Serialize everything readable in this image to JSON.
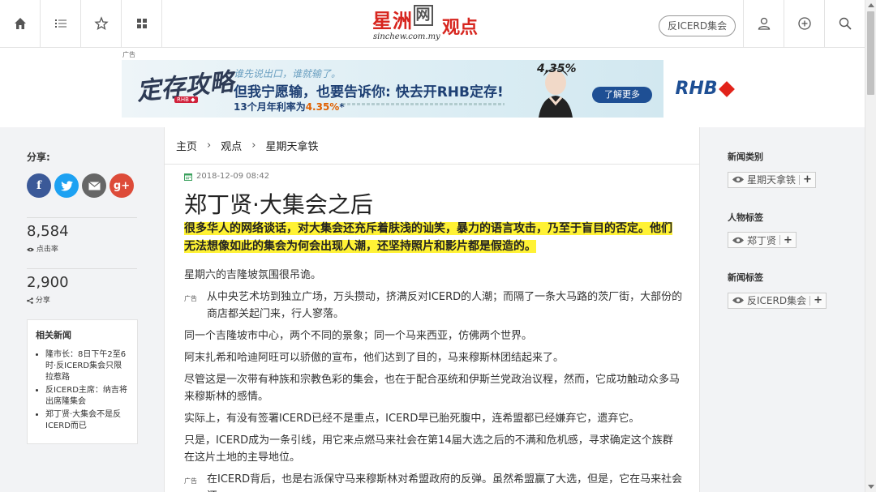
{
  "nav": {
    "left_icons": [
      "home-icon",
      "list-icon",
      "star-icon",
      "grid-icon"
    ],
    "right_icons": [
      "user-icon",
      "plus-circle-icon",
      "search-icon"
    ],
    "logo_text": "星洲",
    "logo_box_text": "网",
    "logo_sub": "sinchew.com.my",
    "section_title": "观点",
    "tag_pill": "反ICERD集会"
  },
  "ad": {
    "label": "广告",
    "brand_script": "定存攻略",
    "brand_tag": "RHB ◆",
    "line1": "谁先说出口，谁就输了。",
    "line2": "但我宁愿输，也要告诉你: 快去开RHB定存!",
    "line3_prefix": "13个月年利率为",
    "line3_rate": "4.35%",
    "line3_suffix": "*",
    "rate_badge": "4.35%",
    "cta": "了解更多",
    "logo": "RHB"
  },
  "share": {
    "title": "分享:",
    "buttons": [
      "f",
      "t",
      "✉",
      "g+"
    ]
  },
  "stats": {
    "views_num": "8,584",
    "views_label": "点击率",
    "shares_num": "2,900",
    "shares_label": "分享"
  },
  "related": {
    "title": "相关新闻",
    "items": [
      "隆市长：8日下午2至6时·反ICERD集会只限拉惹路",
      "反ICERD主席：纳吉将出席隆集会",
      "郑丁贤·大集会不是反ICERD而已"
    ]
  },
  "breadcrumb": [
    "主页",
    "观点",
    "星期天拿铁"
  ],
  "article": {
    "date": "2018-12-09 08:42",
    "title": "郑丁贤·大集会之后",
    "lede": "很多华人的网络谈话，对大集会还充斥着肤浅的讪笑，暴力的语言攻击，乃至于盲目的否定。他们无法想像如此的集会为何会出现人潮，还坚持照片和影片都是假造的。",
    "paragraphs": [
      {
        "ad": "",
        "text": "星期六的吉隆坡氛围很吊诡。"
      },
      {
        "ad": "广告",
        "text": "从中央艺术坊到独立广场，万头攒动，挤满反对ICERD的人潮；而隔了一条大马路的茨厂街，大部份的商店都关起门来，行人寥落。"
      },
      {
        "ad": "",
        "text": "同一个吉隆坡市中心，两个不同的景象；同一个马来西亚，仿佛两个世界。"
      },
      {
        "ad": "",
        "text": "阿末扎希和哈迪阿旺可以骄傲的宣布，他们达到了目的，马来穆斯林团结起来了。"
      },
      {
        "ad": "",
        "text": "尽管这是一次带有种族和宗教色彩的集会，也在于配合巫统和伊斯兰党政治议程，然而，它成功触动众多马来穆斯林的感情。"
      },
      {
        "ad": "",
        "text": "实际上，有没有签署ICERD已经不是重点，ICERD早已胎死腹中，连希盟都已经嫌弃它，遗弃它。"
      },
      {
        "ad": "",
        "text": "只是，ICERD成为一条引线，用它来点燃马来社会在第14届大选之后的不满和危机感，寻求确定这个族群在这片土地的主导地位。"
      },
      {
        "ad": "广告",
        "text": "在ICERD背后，也是右派保守马来穆斯林对希盟政府的反弹。虽然希盟赢了大选，但是，它在马来社会还"
      }
    ]
  },
  "right": {
    "sections": [
      {
        "heading": "新闻类别",
        "chip": "星期天拿铁"
      },
      {
        "heading": "人物标签",
        "chip": "郑丁贤"
      },
      {
        "heading": "新闻标签",
        "chip": "反ICERD集会"
      }
    ]
  },
  "colors": {
    "brand_red": "#d7261f",
    "highlight": "#fff235",
    "facebook": "#3b5998",
    "twitter": "#1da1f2",
    "email": "#666666",
    "gplus": "#dd4b39"
  }
}
